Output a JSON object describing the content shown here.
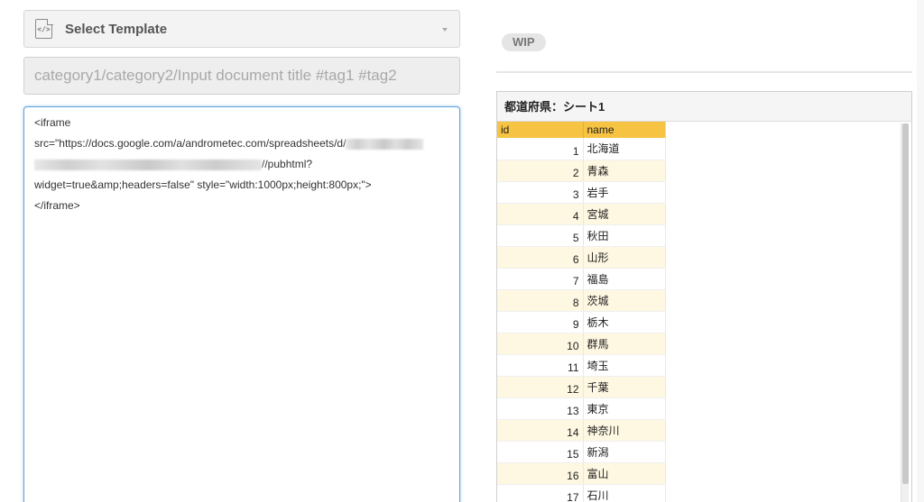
{
  "template_select": {
    "label": "Select Template",
    "icon": "code-document-icon"
  },
  "title_input": {
    "placeholder": "category1/category2/Input document title #tag1 #tag2"
  },
  "editor": {
    "line1": "<iframe",
    "line2_prefix": "src=\"https://docs.google.com/a/andrometec.com/spreadsheets/d/",
    "line3_suffix": "//pubhtml?",
    "line4": "widget=true&amp;headers=false\" style=\"width:1000px;height:800px;\">",
    "line5": "</iframe>"
  },
  "preview": {
    "badge": "WIP",
    "sheet_title": "都道府県：シート1",
    "columns": [
      "id",
      "name"
    ],
    "rows": [
      {
        "id": "1",
        "name": "北海道"
      },
      {
        "id": "2",
        "name": "青森"
      },
      {
        "id": "3",
        "name": "岩手"
      },
      {
        "id": "4",
        "name": "宮城"
      },
      {
        "id": "5",
        "name": "秋田"
      },
      {
        "id": "6",
        "name": "山形"
      },
      {
        "id": "7",
        "name": "福島"
      },
      {
        "id": "8",
        "name": "茨城"
      },
      {
        "id": "9",
        "name": "栃木"
      },
      {
        "id": "10",
        "name": "群馬"
      },
      {
        "id": "11",
        "name": "埼玉"
      },
      {
        "id": "12",
        "name": "千葉"
      },
      {
        "id": "13",
        "name": "東京"
      },
      {
        "id": "14",
        "name": "神奈川"
      },
      {
        "id": "15",
        "name": "新潟"
      },
      {
        "id": "16",
        "name": "富山"
      },
      {
        "id": "17",
        "name": "石川"
      }
    ]
  },
  "colors": {
    "header_accent": "#f6c343",
    "row_alt": "#fef7e1",
    "editor_focus": "#5fa3db"
  }
}
